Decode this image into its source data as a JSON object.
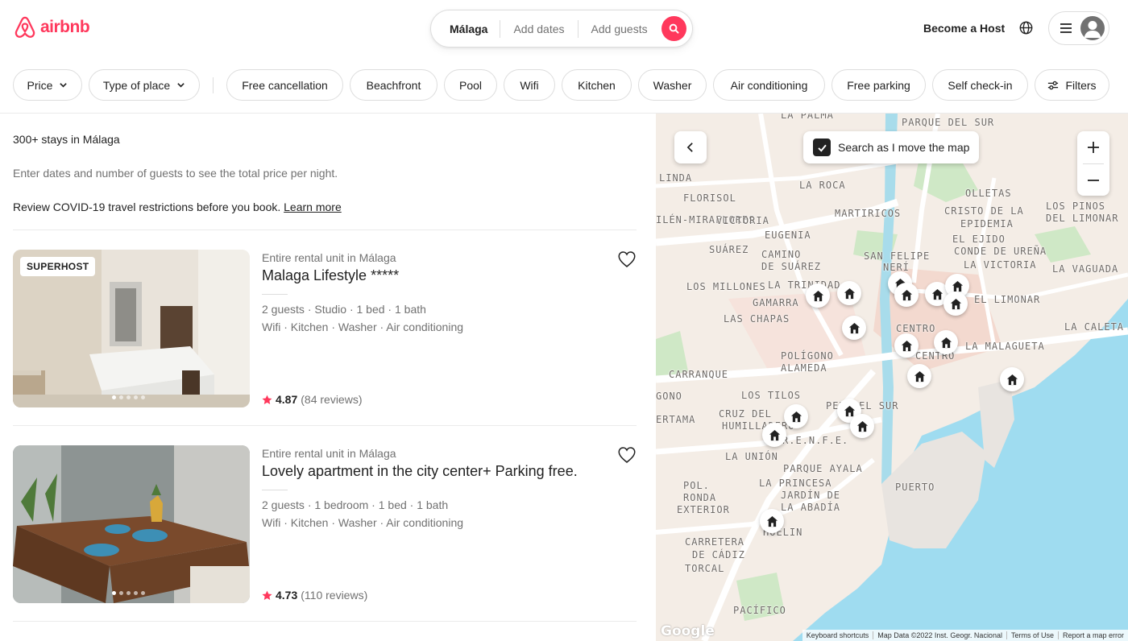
{
  "brand": {
    "name": "airbnb",
    "color": "#FF385C"
  },
  "search": {
    "location": "Málaga",
    "dates": "Add dates",
    "guests": "Add guests"
  },
  "header": {
    "become_host": "Become a Host"
  },
  "filters": {
    "price": "Price",
    "type_of_place": "Type of place",
    "chips": [
      "Free cancellation",
      "Beachfront",
      "Pool",
      "Wifi",
      "Kitchen",
      "Washer",
      "Air conditioning",
      "Free parking",
      "Self check-in"
    ],
    "filters_button": "Filters"
  },
  "results": {
    "count": "300+ stays in Málaga",
    "hint": "Enter dates and number of guests to see the total price per night.",
    "covid": "Review COVID-19 travel restrictions before you book.",
    "learn_more": "Learn more"
  },
  "listings": [
    {
      "badge": "SUPERHOST",
      "type": "Entire rental unit in Málaga",
      "title": "Malaga Lifestyle *****",
      "details": "2 guests · Studio · 1 bed · 1 bath",
      "amenities": "Wifi · Kitchen · Washer · Air conditioning",
      "rating": "4.87",
      "reviews": "(84 reviews)"
    },
    {
      "badge": "",
      "type": "Entire rental unit in Málaga",
      "title": "Lovely apartment in the city center+ Parking free.",
      "details": "2 guests · 1 bedroom · 1 bed · 1 bath",
      "amenities": "Wifi · Kitchen · Washer · Air conditioning",
      "rating": "4.73",
      "reviews": "(110 reviews)"
    }
  ],
  "map": {
    "search_as_move": "Search as I move the map",
    "labels": {
      "l1": "LA PALMA",
      "l2": "PARQUE DEL SUR",
      "l3": "LINDA",
      "l4": "FLORISOL",
      "l5": "LA ROCA",
      "l6": "OLLETAS",
      "l7": "ILÉN-MIRAFLORES",
      "l8": "MARTIRICOS",
      "l9": "CRISTO DE LA",
      "l10": "EPIDEMIA",
      "l11": "LOS PINOS",
      "l12": "DEL LIMONAR",
      "l13": "VICTORIA",
      "l14": "EUGENIA",
      "l15": "SUÁREZ",
      "l16": "CAMINO",
      "l17": "DE SUÁREZ",
      "l18": "SAN FELIPE",
      "l19": "NERÍ",
      "l20": "EL EJIDO",
      "l21": "CONDE DE UREÑA",
      "l22": "LA VICTORIA",
      "l23": "LA VAGUADA",
      "l24": "LOS MILLONES",
      "l25": "LA TRINIDAD",
      "l26": "GAMARRA",
      "l27": "LAS CHAPAS",
      "l28": "CENTRO",
      "l29": "EL LIMONAR",
      "l30": "LA CALETA",
      "l31": "POLÍGONO",
      "l32": "ALAMEDA",
      "l33": "LA MALAGUETA",
      "l34": "CARRANQUE",
      "l35": "LOS TILOS",
      "l36": "PERCHEL SUR",
      "l37": "GONO",
      "l38": "ERTAMA",
      "l39": "CRUZ DEL",
      "l40": "HUMILLADERO",
      "l41": "R.E.N.F.E.",
      "l42": "LA UNIÓN",
      "l43": "PARQUE AYALA",
      "l44": "POL.",
      "l45": "LA PRINCESA",
      "l46": "JARDÍN DE",
      "l47": "LA ABADÍA",
      "l48": "PUERTO",
      "l49": "RONDA",
      "l50": "EXTERIOR",
      "l51": "HUELIN",
      "l52": "CARRETERA",
      "l53": "DE CÁDIZ",
      "l54": "TORCAL",
      "l55": "PACÍFICO",
      "l56": "CENTRO"
    },
    "google": "Google",
    "attribution": [
      "Keyboard shortcuts",
      "Map Data ©2022 Inst. Geogr. Nacional",
      "Terms of Use",
      "Report a map error"
    ]
  }
}
